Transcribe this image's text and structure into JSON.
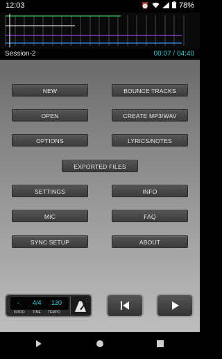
{
  "status": {
    "time": "12:03",
    "battery": "78%",
    "icons": [
      "alarm-icon",
      "wifi-icon",
      "signal-icon",
      "battery-icon"
    ]
  },
  "session": {
    "name": "Session-2",
    "position": "00:07 / 04:40"
  },
  "menu": {
    "new": "NEW",
    "bounce_tracks": "BOUNCE TRACKS",
    "open": "OPEN",
    "create_mp3_wav": "CREATE MP3/WAV",
    "options": "OPTIONS",
    "lyrics_notes": "LYRICS/NOTES",
    "exported_files": "EXPORTED FILES",
    "settings": "SETTINGS",
    "info": "INFO",
    "mic": "MIC",
    "faq": "FAQ",
    "sync_setup": "SYNC SETUP",
    "about": "ABOUT"
  },
  "transport": {
    "intro_value": "-",
    "time_sig": "4/4",
    "tempo": "120",
    "intro_label": "INTRO",
    "time_label": "TIME",
    "tempo_label": "TEMPO"
  },
  "colors": {
    "accent": "#33c7d6",
    "track_green": "#30c06a",
    "track_white": "#d8d8d8",
    "track_purple": "#8a4bd8",
    "track_blue": "#3f8ff0"
  }
}
